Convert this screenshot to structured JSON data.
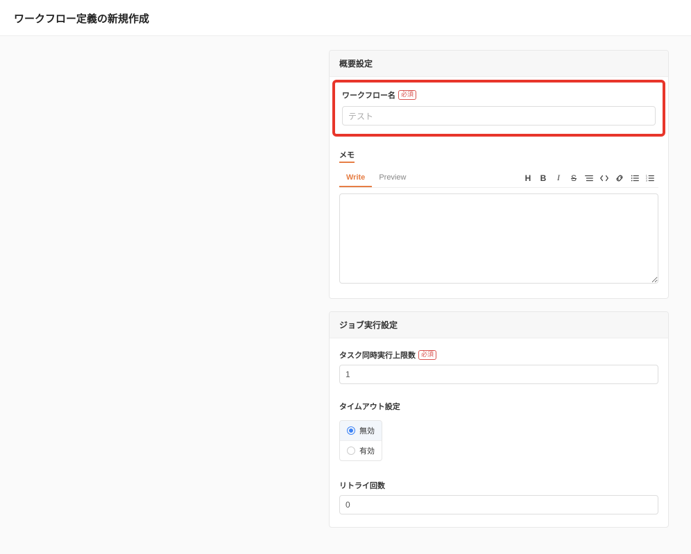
{
  "page": {
    "title": "ワークフロー定義の新規作成"
  },
  "overview": {
    "section_title": "概要設定",
    "name_label": "ワークフロー名",
    "required_badge": "必須",
    "name_value": "テスト",
    "memo_label": "メモ"
  },
  "editor": {
    "tabs": {
      "write": "Write",
      "preview": "Preview"
    }
  },
  "job": {
    "section_title": "ジョブ実行設定",
    "max_tasks_label": "タスク同時実行上限数",
    "required_badge": "必須",
    "max_tasks_value": "1",
    "timeout_label": "タイムアウト設定",
    "timeout_disabled": "無効",
    "timeout_enabled": "有効",
    "retry_label": "リトライ回数",
    "retry_value": "0"
  }
}
